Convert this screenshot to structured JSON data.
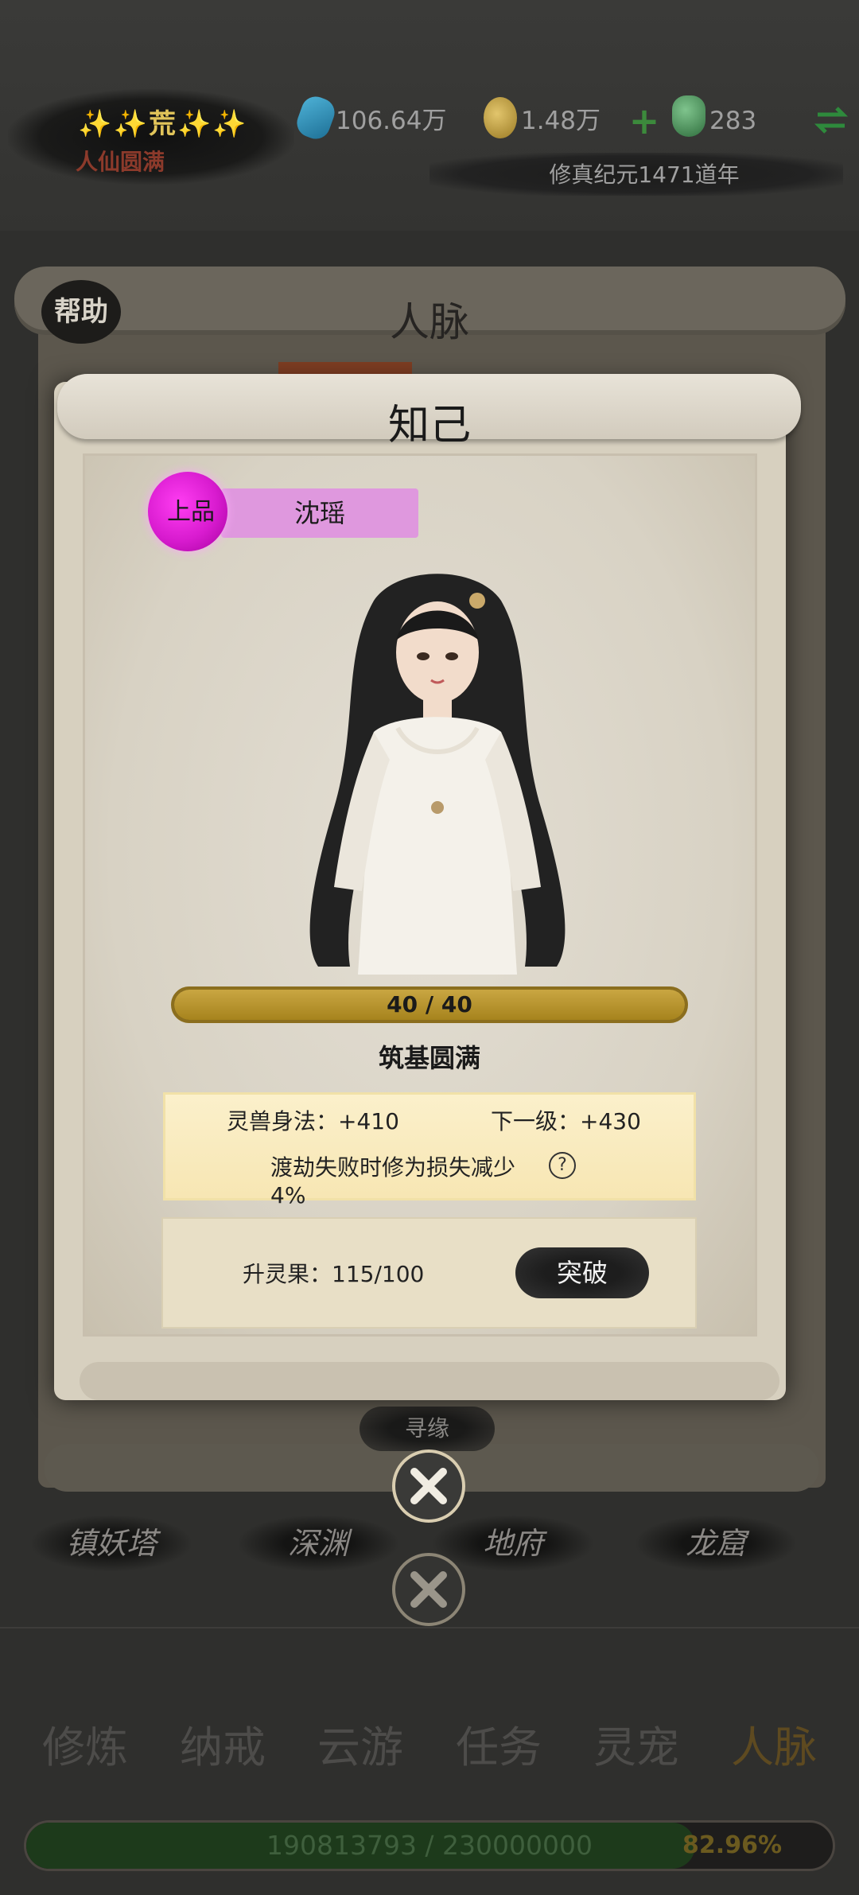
{
  "header": {
    "rank_title": "✨✨荒✨✨",
    "rank_subtitle": "人仙圆满",
    "resources": [
      {
        "icon": "spirit-stone-icon",
        "value": "106.64万"
      },
      {
        "icon": "gold-coin-icon",
        "value": "1.48万"
      },
      {
        "icon": "jade-gourd-icon",
        "value": "283"
      }
    ],
    "add_label": "+",
    "swap_icon": "swap-arrows-icon",
    "era_text": "修真纪元1471道年"
  },
  "background_panel": {
    "help_label": "帮助",
    "title": "人脉",
    "seek_label": "寻缘",
    "regions": [
      "镇妖塔",
      "深渊",
      "地府",
      "龙窟"
    ]
  },
  "dialog": {
    "title": "知己",
    "grade": "上品",
    "name": "沈瑶",
    "progress": {
      "current": 40,
      "max": 40,
      "label": "40 / 40"
    },
    "realm": "筑基圆满",
    "stat_label": "灵兽身法：+410",
    "next_label": "下一级：+430",
    "effect_desc": "渡劫失败时修为损失减少4%",
    "help_mark": "?",
    "fruit_label": "升灵果：115/100",
    "breakthrough_label": "突破"
  },
  "bottom_nav": {
    "tabs": [
      "修炼",
      "纳戒",
      "云游",
      "任务",
      "灵宠",
      "人脉"
    ],
    "active_index": 5
  },
  "xp": {
    "current": 190813793,
    "max": 230000000,
    "label": "190813793 / 230000000",
    "percent_label": "82.96%",
    "fraction": 0.8296
  },
  "colors": {
    "grade_purple": "#d81bcf",
    "progress_gold": "#b8962e",
    "xp_green": "#1d3a1b"
  }
}
